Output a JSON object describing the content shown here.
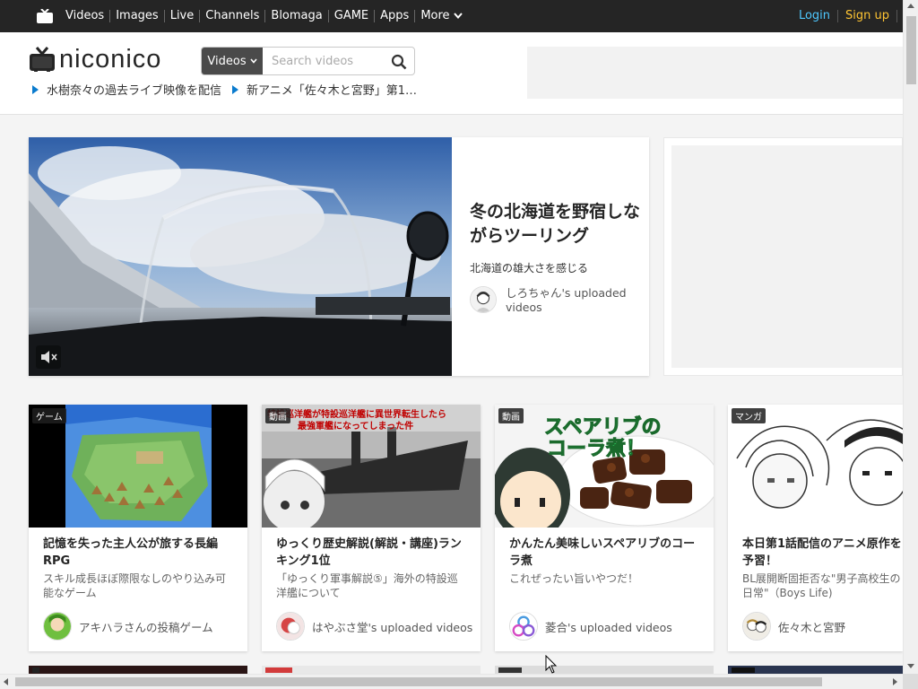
{
  "topbar": {
    "logo_icon": "niconico-tv-icon",
    "nav": [
      "Videos",
      "Images",
      "Live",
      "Channels",
      "Blomaga",
      "GAME",
      "Apps"
    ],
    "more": "More",
    "login": "Login",
    "signup": "Sign up"
  },
  "header": {
    "logo_text": "niconico",
    "search_category": "Videos",
    "search_placeholder": "Search videos",
    "news": [
      "水樹奈々の過去ライブ映像を配信",
      "新アニメ「佐々木と宮野」第1…"
    ]
  },
  "hero": {
    "title": "冬の北海道を野宿しながらツーリング",
    "description": "北海道の雄大さを感じる",
    "owner": "しろちゃん's uploaded videos"
  },
  "cards": [
    {
      "badge": "ゲーム",
      "title": "記憶を失った主人公が旅する長編RPG",
      "description": "スキル成長ほぼ際限なしのやり込み可能なゲーム",
      "owner": "アキハラさんの投稿ゲーム"
    },
    {
      "badge": "動画",
      "title": "ゆっくり歴史解説(解説・講座)ランキング1位",
      "description": "「ゆっくり軍事解説⑤」海外の特設巡洋艦について",
      "owner": "はやぶさ堂's uploaded videos",
      "overlay": "特設巡洋艦が特設巡洋艦に異世界転生したら最強軍艦になってしまった件"
    },
    {
      "badge": "動画",
      "title": "かんたん美味しいスペアリブのコーラ煮",
      "description": "これぜったい旨いやつだ！",
      "owner": "菱合's uploaded videos",
      "overlay": "スペアリブのコーラ煮！"
    },
    {
      "badge": "マンガ",
      "title": "本日第1話配信のアニメ原作を予習！",
      "description": "BL展開断固拒否な\"男子高校生の日常\"（Boys Life)",
      "owner": "佐々木と宮野"
    }
  ],
  "colors": {
    "accent": "#0a7bce",
    "login": "#4ec8ff",
    "signup": "#ffc533",
    "topbar": "#252525"
  }
}
